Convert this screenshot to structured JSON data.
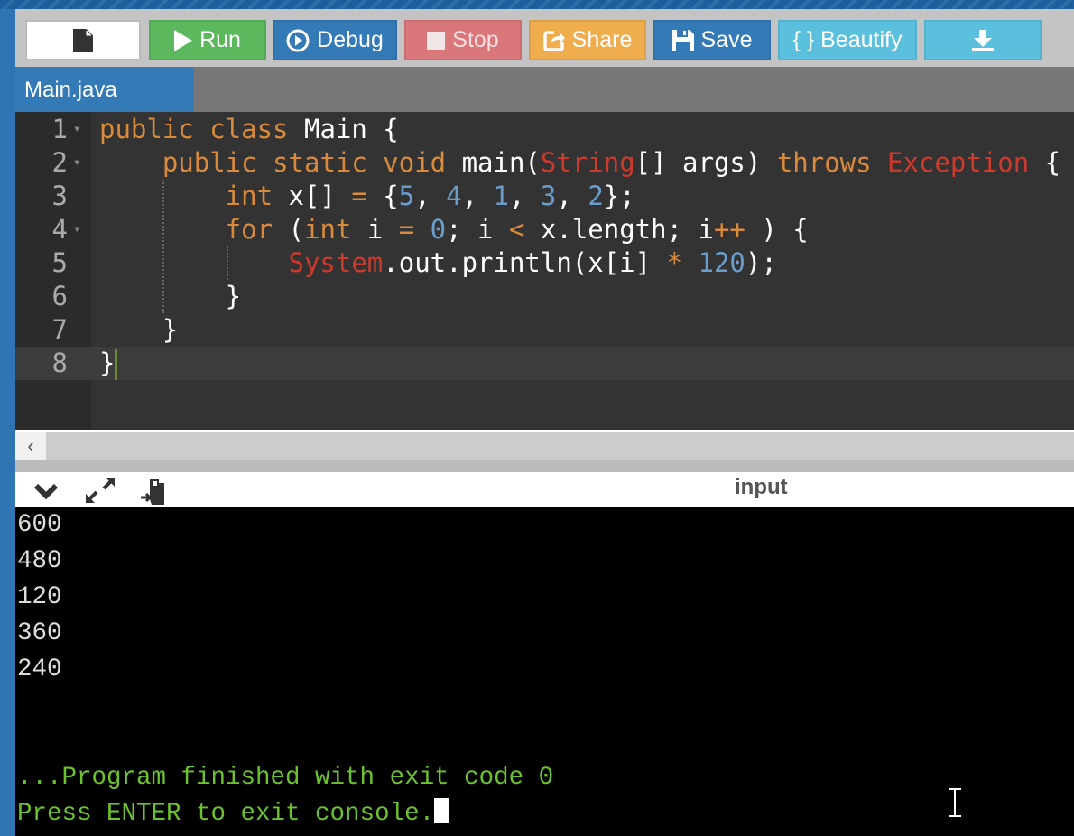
{
  "toolbar": {
    "buttons": [
      {
        "id": "new-file",
        "label": "",
        "icon": "file-icon",
        "color": "#ffffff"
      },
      {
        "id": "run",
        "label": "Run",
        "icon": "play-icon",
        "color": "#5cb85c"
      },
      {
        "id": "debug",
        "label": "Debug",
        "icon": "circle-play-icon",
        "color": "#337ab7"
      },
      {
        "id": "stop",
        "label": "Stop",
        "icon": "stop-icon",
        "color": "#d9777a"
      },
      {
        "id": "share",
        "label": "Share",
        "icon": "share-icon",
        "color": "#f0ad4e"
      },
      {
        "id": "save",
        "label": "Save",
        "icon": "floppy-icon",
        "color": "#337ab7"
      },
      {
        "id": "beautify",
        "label": "{ } Beautify",
        "icon": "",
        "color": "#5bc0de"
      },
      {
        "id": "download",
        "label": "",
        "icon": "download-icon",
        "color": "#5bc0de"
      }
    ]
  },
  "tabs": [
    {
      "label": "Main.java",
      "active": true
    }
  ],
  "editor": {
    "active_line": 8,
    "lines": [
      {
        "n": "1",
        "fold": true,
        "tokens": [
          [
            "public ",
            "kw"
          ],
          [
            "class ",
            "kw"
          ],
          [
            "Main {",
            ""
          ]
        ]
      },
      {
        "n": "2",
        "fold": true,
        "tokens": [
          [
            "    public ",
            "kw"
          ],
          [
            "static ",
            "kw"
          ],
          [
            "void ",
            "kw"
          ],
          [
            "main(",
            ""
          ],
          [
            "String",
            "ty"
          ],
          [
            "[] args) ",
            ""
          ],
          [
            "throws ",
            "kw"
          ],
          [
            "Exception",
            "ty"
          ],
          [
            " {",
            ""
          ]
        ]
      },
      {
        "n": "3",
        "fold": false,
        "tokens": [
          [
            "        int ",
            "kw"
          ],
          [
            "x[] ",
            ""
          ],
          [
            "= ",
            "op"
          ],
          [
            "{",
            ""
          ],
          [
            "5",
            "nu"
          ],
          [
            ", ",
            ""
          ],
          [
            "4",
            "nu"
          ],
          [
            ", ",
            ""
          ],
          [
            "1",
            "nu"
          ],
          [
            ", ",
            ""
          ],
          [
            "3",
            "nu"
          ],
          [
            ", ",
            ""
          ],
          [
            "2",
            "nu"
          ],
          [
            "};",
            ""
          ]
        ]
      },
      {
        "n": "4",
        "fold": true,
        "tokens": [
          [
            "        for ",
            "kw"
          ],
          [
            "(",
            ""
          ],
          [
            "int ",
            "kw"
          ],
          [
            "i ",
            ""
          ],
          [
            "= ",
            "op"
          ],
          [
            "0",
            "nu"
          ],
          [
            "; i ",
            ""
          ],
          [
            "< ",
            "op"
          ],
          [
            "x.length; i",
            ""
          ],
          [
            "++ ",
            "op"
          ],
          [
            ") {",
            ""
          ]
        ]
      },
      {
        "n": "5",
        "fold": false,
        "tokens": [
          [
            "            System",
            "ty"
          ],
          [
            ".out.println(x[i] ",
            ""
          ],
          [
            "* ",
            "op"
          ],
          [
            "120",
            "nu"
          ],
          [
            ");",
            ""
          ]
        ]
      },
      {
        "n": "6",
        "fold": false,
        "tokens": [
          [
            "        }",
            ""
          ]
        ]
      },
      {
        "n": "7",
        "fold": false,
        "tokens": [
          [
            "    }",
            ""
          ]
        ]
      },
      {
        "n": "8",
        "fold": false,
        "tokens": [
          [
            "}",
            ""
          ]
        ]
      }
    ]
  },
  "console_toolbar": {
    "label": "input",
    "icons": [
      "chevron-down-icon",
      "expand-icon",
      "paste-icon"
    ]
  },
  "console": {
    "output": [
      "600",
      "480",
      "120",
      "360",
      "240"
    ],
    "finish": "...Program finished with exit code 0",
    "prompt": "Press ENTER to exit console."
  }
}
